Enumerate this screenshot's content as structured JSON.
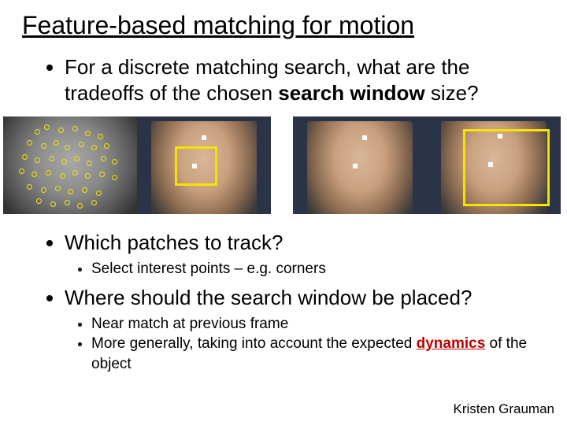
{
  "title": "Feature-based matching for motion",
  "bullet1_pre": "For a discrete matching search, what are the tradeoffs of the chosen ",
  "bullet1_bold": "search window",
  "bullet1_post": " size?",
  "bullet2": "Which patches to track?",
  "bullet2_sub1": "Select interest points – e.g. corners",
  "bullet3": "Where should the search window be placed?",
  "bullet3_sub1": "Near match at previous frame",
  "bullet3_sub2_pre": "More generally, taking into account the expected ",
  "bullet3_sub2_dyn": "dynamics",
  "bullet3_sub2_post": " of the object",
  "credit": "Kristen Grauman"
}
